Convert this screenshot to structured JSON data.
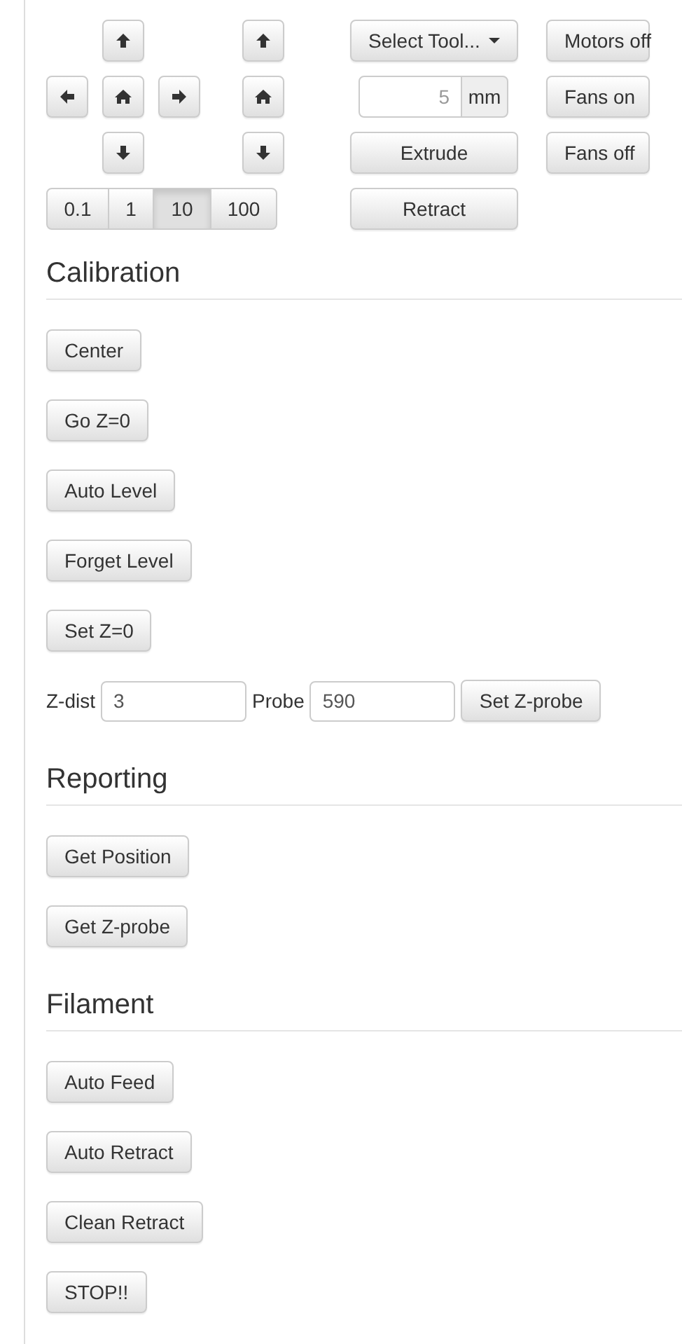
{
  "steps": [
    {
      "label": "0.1",
      "selected": false
    },
    {
      "label": "1",
      "selected": false
    },
    {
      "label": "10",
      "selected": true
    },
    {
      "label": "100",
      "selected": false
    }
  ],
  "tool_select": {
    "label": "Select Tool..."
  },
  "extrude_amount": {
    "placeholder": "5",
    "unit": "mm"
  },
  "extruder_buttons": [
    "Extrude",
    "Retract"
  ],
  "power_buttons": [
    "Motors off",
    "Fans on",
    "Fans off"
  ],
  "sections": [
    {
      "title": "Calibration",
      "rows": [
        {
          "kind": "button",
          "label": "Center"
        },
        {
          "kind": "button",
          "label": "Go Z=0"
        },
        {
          "kind": "button",
          "label": "Auto Level"
        },
        {
          "kind": "button",
          "label": "Forget Level"
        },
        {
          "kind": "button",
          "label": "Set Z=0"
        },
        {
          "kind": "probe",
          "zdist_label": "Z-dist",
          "zdist_value": "3",
          "probe_label": "Probe",
          "probe_value": "590",
          "button": "Set Z-probe"
        }
      ]
    },
    {
      "title": "Reporting",
      "rows": [
        {
          "kind": "button",
          "label": "Get Position"
        },
        {
          "kind": "button",
          "label": "Get Z-probe"
        }
      ]
    },
    {
      "title": "Filament",
      "rows": [
        {
          "kind": "button",
          "label": "Auto Feed"
        },
        {
          "kind": "button",
          "label": "Auto Retract"
        },
        {
          "kind": "button",
          "label": "Clean Retract"
        },
        {
          "kind": "button",
          "label": "STOP!!"
        }
      ]
    }
  ]
}
